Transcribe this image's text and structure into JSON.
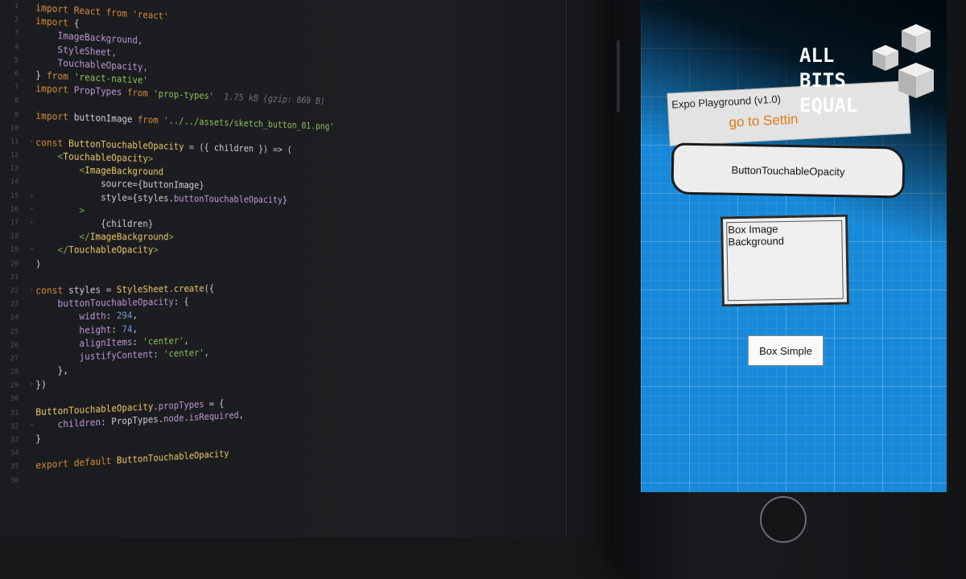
{
  "editor": {
    "lines": [
      {
        "n": "1",
        "parts": [
          {
            "c": "kw",
            "t": "import React from 'react'"
          }
        ]
      },
      {
        "n": "2",
        "parts": [
          {
            "c": "kw",
            "t": "import "
          },
          {
            "c": "punc",
            "t": "{"
          }
        ]
      },
      {
        "n": "3",
        "parts": [
          {
            "c": "prop",
            "t": "    ImageBackground,"
          }
        ]
      },
      {
        "n": "4",
        "parts": [
          {
            "c": "prop",
            "t": "    StyleSheet,"
          }
        ]
      },
      {
        "n": "5",
        "parts": [
          {
            "c": "prop",
            "t": "    TouchableOpacity,"
          }
        ]
      },
      {
        "n": "6",
        "parts": [
          {
            "c": "punc",
            "t": "} "
          },
          {
            "c": "kw",
            "t": "from "
          },
          {
            "c": "str",
            "t": "'react-native'"
          }
        ]
      },
      {
        "n": "7",
        "parts": [
          {
            "c": "kw",
            "t": "import "
          },
          {
            "c": "prop",
            "t": "PropTypes "
          },
          {
            "c": "kw",
            "t": "from "
          },
          {
            "c": "str",
            "t": "'prop-types'"
          },
          {
            "c": "cm",
            "t": "  1.75 kB (gzip: 869 B)"
          }
        ]
      },
      {
        "n": "8",
        "parts": []
      },
      {
        "n": "9",
        "parts": [
          {
            "c": "kw",
            "t": "import "
          },
          {
            "c": "var",
            "t": "buttonImage "
          },
          {
            "c": "kw",
            "t": "from "
          },
          {
            "c": "str",
            "t": "'../../assets/sketch_button_01.png'"
          }
        ]
      },
      {
        "n": "10",
        "parts": []
      },
      {
        "n": "11",
        "parts": [
          {
            "c": "kw",
            "t": "const "
          },
          {
            "c": "fn",
            "t": "ButtonTouchableOpacity "
          },
          {
            "c": "punc",
            "t": "= ({ "
          },
          {
            "c": "var",
            "t": "children "
          },
          {
            "c": "punc",
            "t": "}) => ("
          }
        ]
      },
      {
        "n": "12",
        "parts": [
          {
            "c": "jsx",
            "t": "    <"
          },
          {
            "c": "comp",
            "t": "TouchableOpacity"
          },
          {
            "c": "jsx",
            "t": ">"
          }
        ]
      },
      {
        "n": "13",
        "parts": [
          {
            "c": "jsx",
            "t": "        <"
          },
          {
            "c": "comp",
            "t": "ImageBackground"
          }
        ]
      },
      {
        "n": "14",
        "parts": [
          {
            "c": "var",
            "t": "            source"
          },
          {
            "c": "punc",
            "t": "={"
          },
          {
            "c": "var",
            "t": "buttonImage"
          },
          {
            "c": "punc",
            "t": "}"
          }
        ]
      },
      {
        "n": "15",
        "parts": [
          {
            "c": "var",
            "t": "            style"
          },
          {
            "c": "punc",
            "t": "={"
          },
          {
            "c": "var",
            "t": "styles."
          },
          {
            "c": "prop",
            "t": "buttonTouchableOpacity"
          },
          {
            "c": "punc",
            "t": "}"
          }
        ]
      },
      {
        "n": "16",
        "parts": [
          {
            "c": "jsx",
            "t": "        >"
          }
        ]
      },
      {
        "n": "17",
        "parts": [
          {
            "c": "punc",
            "t": "            {children}"
          }
        ]
      },
      {
        "n": "18",
        "parts": [
          {
            "c": "jsx",
            "t": "        </"
          },
          {
            "c": "comp",
            "t": "ImageBackground"
          },
          {
            "c": "jsx",
            "t": ">"
          }
        ]
      },
      {
        "n": "19",
        "parts": [
          {
            "c": "jsx",
            "t": "    </"
          },
          {
            "c": "comp",
            "t": "TouchableOpacity"
          },
          {
            "c": "jsx",
            "t": ">"
          }
        ]
      },
      {
        "n": "20",
        "parts": [
          {
            "c": "punc",
            "t": ")"
          }
        ]
      },
      {
        "n": "21",
        "parts": []
      },
      {
        "n": "22",
        "parts": [
          {
            "c": "kw",
            "t": "const "
          },
          {
            "c": "var",
            "t": "styles "
          },
          {
            "c": "punc",
            "t": "= "
          },
          {
            "c": "fn",
            "t": "StyleSheet."
          },
          {
            "c": "fn",
            "t": "create"
          },
          {
            "c": "punc",
            "t": "({"
          }
        ]
      },
      {
        "n": "23",
        "parts": [
          {
            "c": "prop",
            "t": "    buttonTouchableOpacity"
          },
          {
            "c": "punc",
            "t": ": {"
          }
        ]
      },
      {
        "n": "24",
        "parts": [
          {
            "c": "prop",
            "t": "        width"
          },
          {
            "c": "punc",
            "t": ": "
          },
          {
            "c": "num",
            "t": "294"
          },
          {
            "c": "punc",
            "t": ","
          }
        ]
      },
      {
        "n": "25",
        "parts": [
          {
            "c": "prop",
            "t": "        height"
          },
          {
            "c": "punc",
            "t": ": "
          },
          {
            "c": "num",
            "t": "74"
          },
          {
            "c": "punc",
            "t": ","
          }
        ]
      },
      {
        "n": "26",
        "parts": [
          {
            "c": "prop",
            "t": "        alignItems"
          },
          {
            "c": "punc",
            "t": ": "
          },
          {
            "c": "str",
            "t": "'center'"
          },
          {
            "c": "punc",
            "t": ","
          }
        ]
      },
      {
        "n": "27",
        "parts": [
          {
            "c": "prop",
            "t": "        justifyContent"
          },
          {
            "c": "punc",
            "t": ": "
          },
          {
            "c": "str",
            "t": "'center'"
          },
          {
            "c": "punc",
            "t": ","
          }
        ]
      },
      {
        "n": "28",
        "parts": [
          {
            "c": "punc",
            "t": "    },"
          }
        ]
      },
      {
        "n": "29",
        "parts": [
          {
            "c": "punc",
            "t": "})"
          }
        ]
      },
      {
        "n": "30",
        "parts": []
      },
      {
        "n": "31",
        "parts": [
          {
            "c": "fn",
            "t": "ButtonTouchableOpacity"
          },
          {
            "c": "punc",
            "t": "."
          },
          {
            "c": "prop",
            "t": "propTypes "
          },
          {
            "c": "punc",
            "t": "= {"
          }
        ]
      },
      {
        "n": "32",
        "parts": [
          {
            "c": "prop",
            "t": "    children"
          },
          {
            "c": "punc",
            "t": ": "
          },
          {
            "c": "var",
            "t": "PropTypes."
          },
          {
            "c": "prop",
            "t": "node"
          },
          {
            "c": "punc",
            "t": "."
          },
          {
            "c": "prop",
            "t": "isRequired"
          },
          {
            "c": "punc",
            "t": ","
          }
        ]
      },
      {
        "n": "33",
        "parts": [
          {
            "c": "punc",
            "t": "}"
          }
        ]
      },
      {
        "n": "34",
        "parts": []
      },
      {
        "n": "35",
        "parts": [
          {
            "c": "kw",
            "t": "export default "
          },
          {
            "c": "fn",
            "t": "ButtonTouchableOpacity"
          }
        ]
      },
      {
        "n": "36",
        "parts": []
      }
    ],
    "folds": [
      "11",
      "15",
      "16",
      "17",
      "19",
      "22",
      "29",
      "32"
    ]
  },
  "app": {
    "title": "Expo Playground (v1.0)",
    "settings_link": "go to Settin",
    "sketch_button_label": "ButtonTouchableOpacity",
    "box_image_label": "Box Image Background",
    "box_simple_label": "Box Simple"
  },
  "brand": {
    "line1": "ALL",
    "line2": "BITS",
    "line3": "EQUAL"
  },
  "colors": {
    "screen_blue": "#1789d8",
    "settings_orange": "#e07a12",
    "editor_bg": "#1c1d20"
  }
}
